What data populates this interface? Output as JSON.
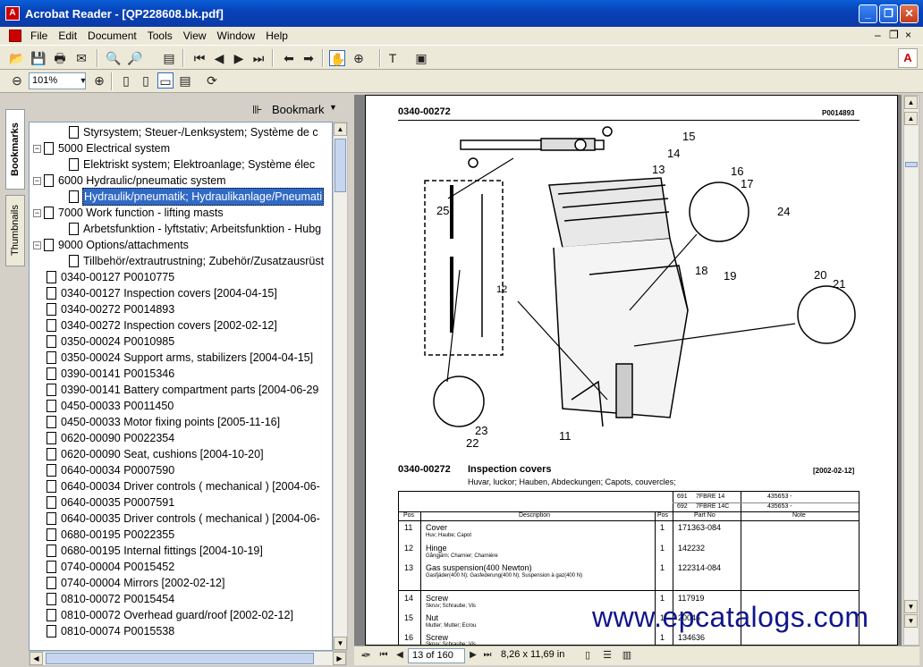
{
  "window": {
    "title": "Acrobat Reader - [QP228608.bk.pdf]"
  },
  "menu": {
    "items": [
      "File",
      "Edit",
      "Document",
      "Tools",
      "View",
      "Window",
      "Help"
    ]
  },
  "toolbar": {
    "zoom_value": "101%"
  },
  "nav_panel": {
    "tabs": [
      "Bookmarks",
      "Thumbnails"
    ],
    "header_label": "Bookmark",
    "tree": [
      {
        "label": "Styrsystem; Steuer-/Lenksystem; Système de c",
        "depth": 1,
        "expander": ""
      },
      {
        "label": "5000 Electrical system",
        "depth": 0,
        "expander": "−"
      },
      {
        "label": "Elektriskt system; Elektroanlage; Système élec",
        "depth": 1,
        "expander": ""
      },
      {
        "label": "6000 Hydraulic/pneumatic system",
        "depth": 0,
        "expander": "−"
      },
      {
        "label": "Hydraulik/pneumatik; Hydraulikanlage/Pneumati",
        "depth": 1,
        "expander": "",
        "selected": true
      },
      {
        "label": "7000 Work function - lifting masts",
        "depth": 0,
        "expander": "−"
      },
      {
        "label": "Arbetsfunktion - lyftstativ; Arbeitsfunktion - Hubg",
        "depth": 1,
        "expander": ""
      },
      {
        "label": "9000 Options/attachments",
        "depth": 0,
        "expander": "−"
      },
      {
        "label": "Tillbehör/extrautrustning; Zubehör/Zusatzausrüst",
        "depth": 1,
        "expander": ""
      },
      {
        "label": "0340-00127 P0010775",
        "depth": 0,
        "expander": ""
      },
      {
        "label": "0340-00127 Inspection covers [2004-04-15]",
        "depth": 0,
        "expander": ""
      },
      {
        "label": "0340-00272 P0014893",
        "depth": 0,
        "expander": ""
      },
      {
        "label": "0340-00272 Inspection covers [2002-02-12]",
        "depth": 0,
        "expander": ""
      },
      {
        "label": "0350-00024 P0010985",
        "depth": 0,
        "expander": ""
      },
      {
        "label": "0350-00024 Support arms, stabilizers [2004-04-15]",
        "depth": 0,
        "expander": ""
      },
      {
        "label": "0390-00141 P0015346",
        "depth": 0,
        "expander": ""
      },
      {
        "label": "0390-00141 Battery compartment parts [2004-06-29",
        "depth": 0,
        "expander": ""
      },
      {
        "label": "0450-00033 P0011450",
        "depth": 0,
        "expander": ""
      },
      {
        "label": "0450-00033 Motor fixing points [2005-11-16]",
        "depth": 0,
        "expander": ""
      },
      {
        "label": "0620-00090 P0022354",
        "depth": 0,
        "expander": ""
      },
      {
        "label": "0620-00090 Seat, cushions [2004-10-20]",
        "depth": 0,
        "expander": ""
      },
      {
        "label": "0640-00034 P0007590",
        "depth": 0,
        "expander": ""
      },
      {
        "label": "0640-00034 Driver controls ( mechanical ) [2004-06-",
        "depth": 0,
        "expander": ""
      },
      {
        "label": "0640-00035 P0007591",
        "depth": 0,
        "expander": ""
      },
      {
        "label": "0640-00035 Driver controls ( mechanical ) [2004-06-",
        "depth": 0,
        "expander": ""
      },
      {
        "label": "0680-00195 P0022355",
        "depth": 0,
        "expander": ""
      },
      {
        "label": "0680-00195 Internal fittings [2004-10-19]",
        "depth": 0,
        "expander": ""
      },
      {
        "label": "0740-00004 P0015452",
        "depth": 0,
        "expander": ""
      },
      {
        "label": "0740-00004 Mirrors [2002-02-12]",
        "depth": 0,
        "expander": ""
      },
      {
        "label": "0810-00072 P0015454",
        "depth": 0,
        "expander": ""
      },
      {
        "label": "0810-00072 Overhead guard/roof [2002-02-12]",
        "depth": 0,
        "expander": ""
      },
      {
        "label": "0810-00074 P0015538",
        "depth": 0,
        "expander": ""
      }
    ]
  },
  "document": {
    "page_code": "0340-00272",
    "page_ref": "P0014893",
    "callouts": [
      "15",
      "14",
      "13",
      "16",
      "17",
      "24",
      "18",
      "19",
      "20",
      "21",
      "25",
      "12",
      "11",
      "23",
      "22"
    ],
    "section_code": "0340-00272",
    "section_title": "Inspection covers",
    "section_date": "[2002-02-12]",
    "section_subtitle": "Huvar, luckor; Hauben, Abdeckungen; Capots, couvercles;",
    "model_rows": [
      {
        "a": "691",
        "b": "7FBRE 14",
        "c": "435653 -"
      },
      {
        "a": "692",
        "b": "7FBRE 14C",
        "c": "435653 -"
      }
    ],
    "table_headers": {
      "pos": "Pos",
      "description": "Description",
      "pos2": "Pos",
      "part_no": "Part No",
      "note": "Note"
    },
    "parts": [
      {
        "pos": "11",
        "name": "Cover",
        "sub": "Huv; Haube; Capot",
        "qty": "1",
        "part": "171363-084"
      },
      {
        "pos": "12",
        "name": "Hinge",
        "sub": "Gångjärn; Charnier; Charnière",
        "qty": "1",
        "part": "142232"
      },
      {
        "pos": "13",
        "name": "Gas suspension(400 Newton)",
        "sub": "Gasfjäder(400 N); Gasfederung(400 N); Suspension à gaz(400 N)",
        "qty": "1",
        "part": "122314-084"
      },
      {
        "pos": "14",
        "name": "Screw",
        "sub": "Skruv; Schraube; Vis",
        "qty": "1",
        "part": "117919"
      },
      {
        "pos": "15",
        "name": "Nut",
        "sub": "Mutter; Mutter; Ecrou",
        "qty": "1",
        "part": "20046"
      },
      {
        "pos": "16",
        "name": "Screw",
        "sub": "Skruv; Schraube; Vis",
        "qty": "1",
        "part": "134636"
      }
    ]
  },
  "statusbar": {
    "page_indicator": "13 of 160",
    "page_size": "8,26 x 11,69 in"
  },
  "watermark": "www.epcatalogs.com"
}
